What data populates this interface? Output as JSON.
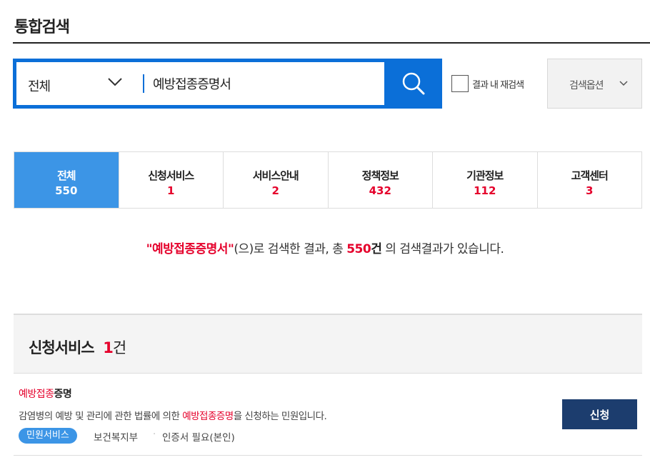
{
  "page": {
    "title": "통합검색"
  },
  "search": {
    "scope": "전체",
    "query": "예방접종증명서",
    "resort_label": "결과 내 재검색",
    "options_label": "검색옵션"
  },
  "tabs": [
    {
      "label": "전체",
      "count": "550",
      "active": true
    },
    {
      "label": "신청서비스",
      "count": "1"
    },
    {
      "label": "서비스안내",
      "count": "2"
    },
    {
      "label": "정책정보",
      "count": "432"
    },
    {
      "label": "기관정보",
      "count": "112"
    },
    {
      "label": "고객센터",
      "count": "3"
    }
  ],
  "summary": {
    "open_quote": "\"",
    "keyword": "예방접종증명서",
    "close_quote": "\"",
    "mid": "(으)로 검색한 결과, 총 ",
    "total": "550",
    "unit": "건",
    "tail": " 의 검색결과가 있습니다."
  },
  "section": {
    "title": "신청서비스",
    "count": "1",
    "unit": "건"
  },
  "result": {
    "title_hl": "예방접종",
    "title_rest": "증명",
    "desc_pre": "감염병의 예방 및 관리에 관한 법률에 의한 ",
    "desc_hl": "예방접종증명",
    "desc_post": "을 신청하는 민원입니다.",
    "badge": "민원서비스",
    "org": "보건복지부",
    "separator": "·",
    "cert": "인증서 필요(본인)",
    "apply_label": "신청"
  },
  "colors": {
    "primary": "#0b6fd8",
    "tab_active": "#3c95e6",
    "highlight": "#e5002b",
    "apply": "#1c3d6e"
  }
}
